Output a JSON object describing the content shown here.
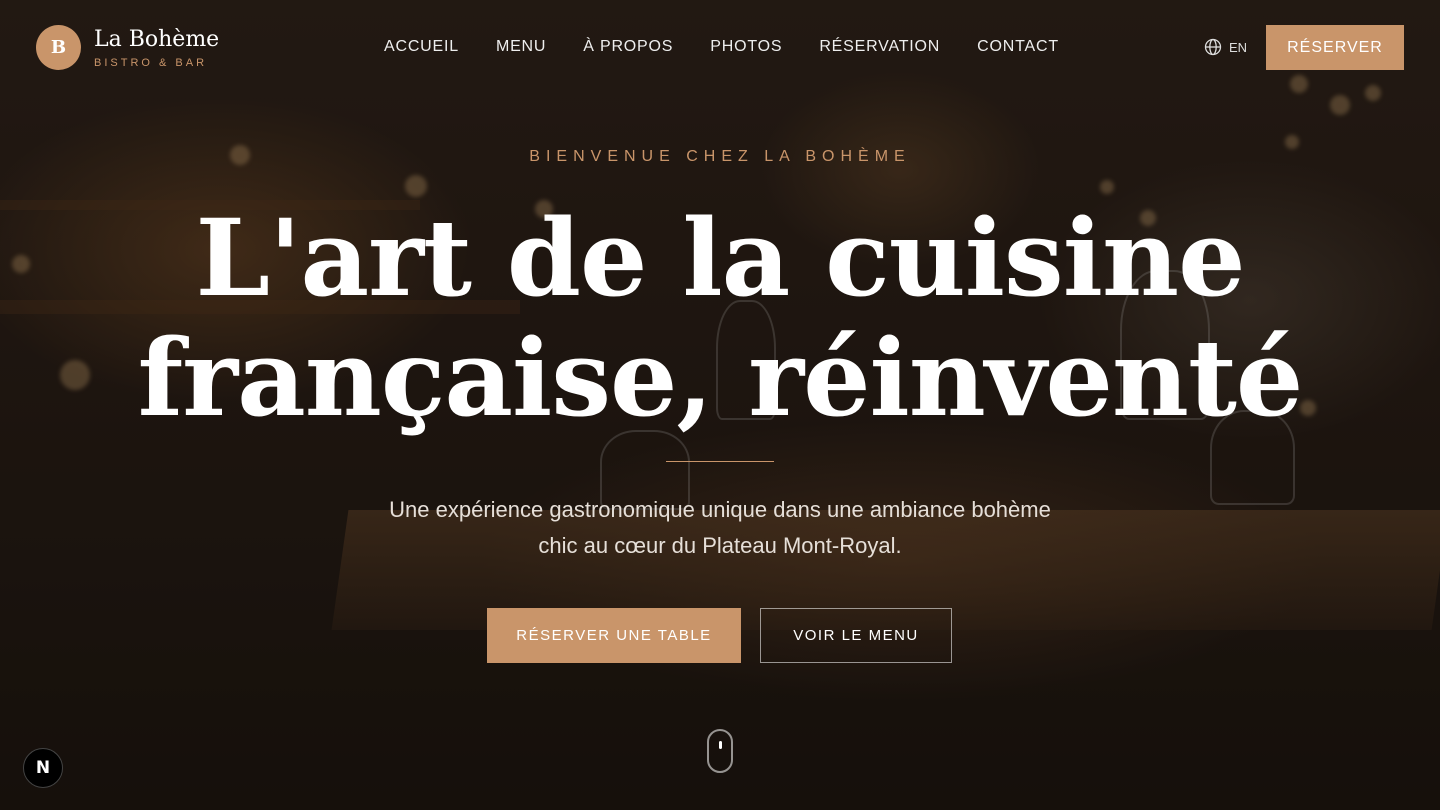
{
  "brand": {
    "initial": "B",
    "name": "La Bohème",
    "tagline": "BISTRO & BAR"
  },
  "nav": {
    "items": [
      {
        "label": "ACCUEIL"
      },
      {
        "label": "MENU"
      },
      {
        "label": "À PROPOS"
      },
      {
        "label": "PHOTOS"
      },
      {
        "label": "RÉSERVATION"
      },
      {
        "label": "CONTACT"
      }
    ]
  },
  "language": {
    "icon": "globe-icon",
    "label": "EN"
  },
  "header_cta": {
    "label": "RÉSERVER"
  },
  "hero": {
    "kicker": "BIENVENUE CHEZ LA BOHÈME",
    "headline_line1": "L'art de la cuisine",
    "headline_line2": "française, réinventé",
    "subtitle_line1": "Une expérience gastronomique unique dans une ambiance bohème",
    "subtitle_line2": "chic au cœur du Plateau Mont-Royal.",
    "primary_cta": "RÉSERVER UNE TABLE",
    "secondary_cta": "VOIR LE MENU"
  },
  "dev_badge": {
    "letter": "N"
  },
  "colors": {
    "accent": "#c9956a",
    "background": "#1c140f",
    "text": "#ffffff"
  }
}
